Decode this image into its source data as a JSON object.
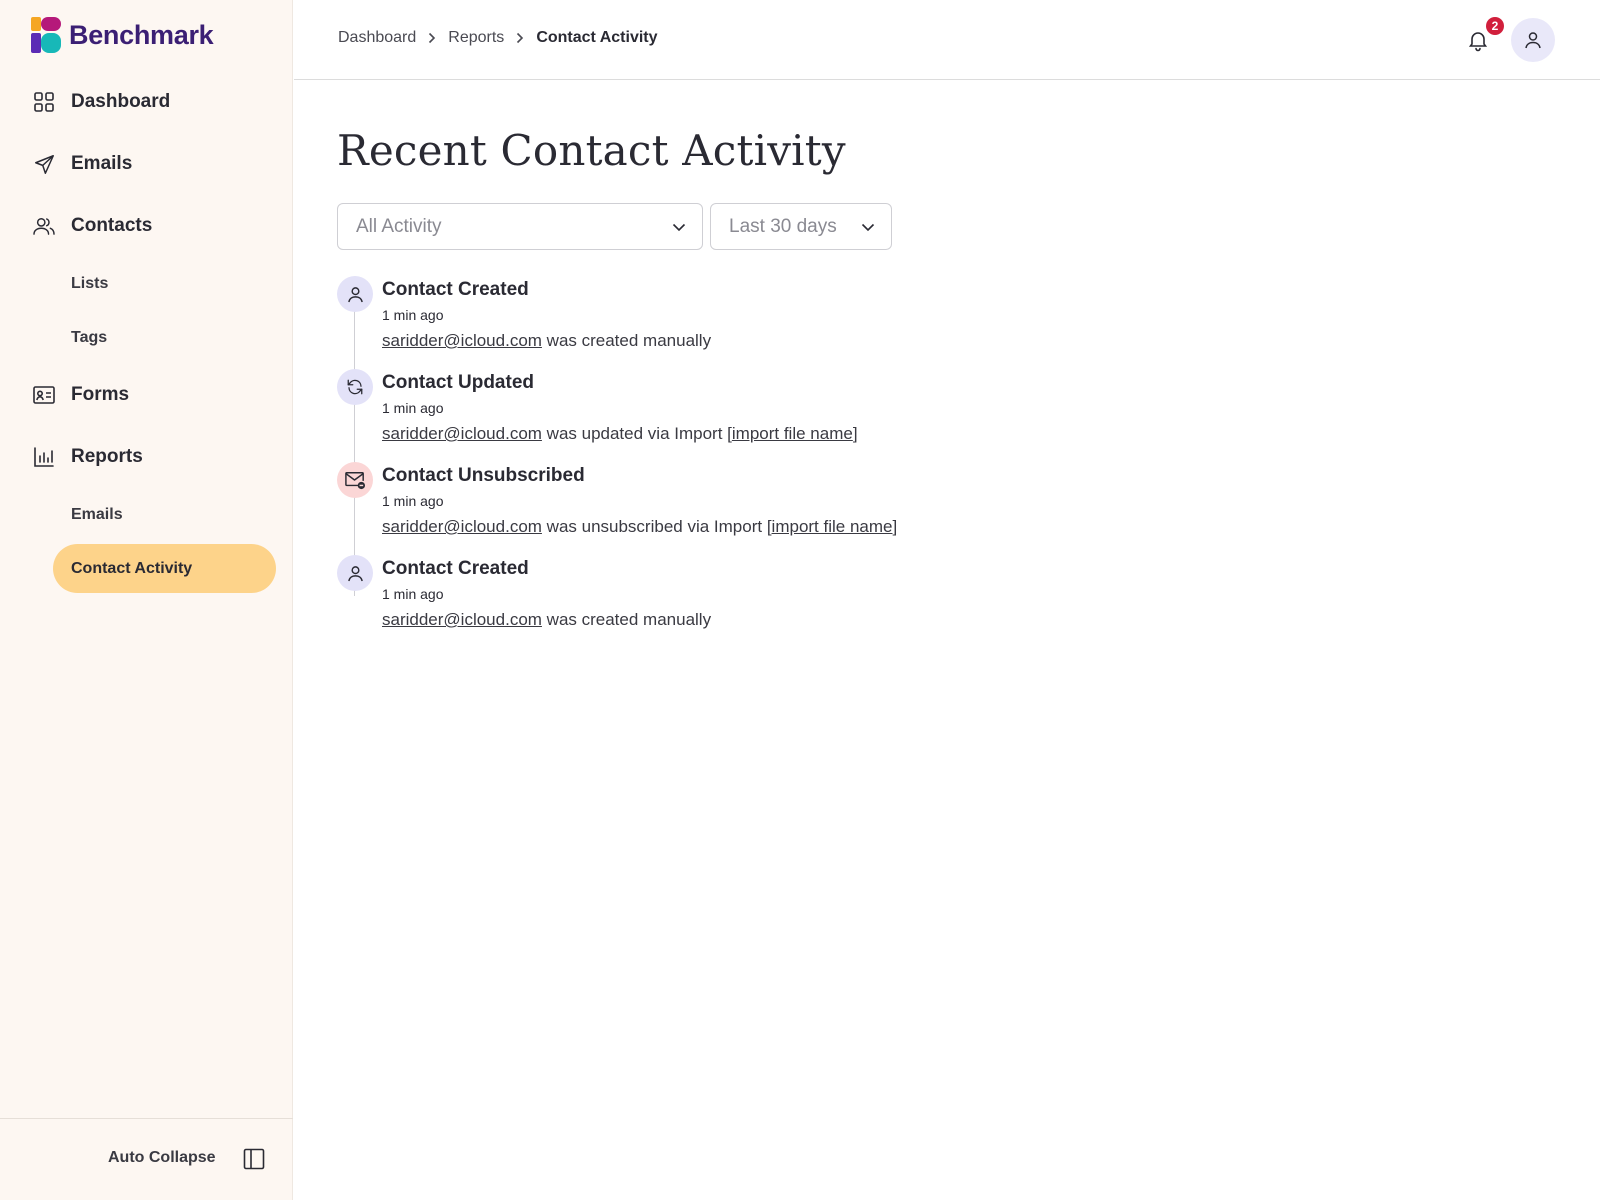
{
  "brand": {
    "name": "Benchmark"
  },
  "sidebar": {
    "items": [
      {
        "label": "Dashboard",
        "icon": "grid-icon"
      },
      {
        "label": "Emails",
        "icon": "send-icon"
      },
      {
        "label": "Contacts",
        "icon": "users-icon"
      },
      {
        "label": "Forms",
        "icon": "id-card-icon"
      },
      {
        "label": "Reports",
        "icon": "bar-chart-icon"
      }
    ],
    "contacts_sub": [
      "Lists",
      "Tags"
    ],
    "reports_sub": [
      "Emails",
      "Contact Activity"
    ],
    "active_sub": "Contact Activity",
    "footer": {
      "auto_collapse": "Auto Collapse"
    }
  },
  "header": {
    "breadcrumb": [
      "Dashboard",
      "Reports",
      "Contact Activity"
    ],
    "notification_count": "2"
  },
  "main": {
    "title": "Recent Contact Activity",
    "filters": {
      "activity": "All Activity",
      "range": "Last 30 days"
    },
    "activities": [
      {
        "type": "created",
        "title": "Contact Created",
        "time": "1 min ago",
        "email": "saridder@icloud.com",
        "text": " was created manually",
        "file": ""
      },
      {
        "type": "updated",
        "title": "Contact Updated",
        "time": "1 min ago",
        "email": "saridder@icloud.com",
        "text": " was updated via Import [",
        "file": "import file name"
      },
      {
        "type": "unsubscribed",
        "title": "Contact Unsubscribed",
        "time": "1 min ago",
        "email": "saridder@icloud.com",
        "text": " was unsubscribed via Import [",
        "file": "import file name"
      },
      {
        "type": "created",
        "title": "Contact Created",
        "time": "1 min ago",
        "email": "saridder@icloud.com",
        "text": " was created manually",
        "file": ""
      }
    ]
  },
  "colors": {
    "sidebar_bg": "#fdf7f2",
    "active_pill": "#fdd38a",
    "brand_text": "#3b1f74",
    "badge": "#d11f3c",
    "icon_bg": "#e3e2f8",
    "icon_bg_alert": "#fbd6d6"
  }
}
